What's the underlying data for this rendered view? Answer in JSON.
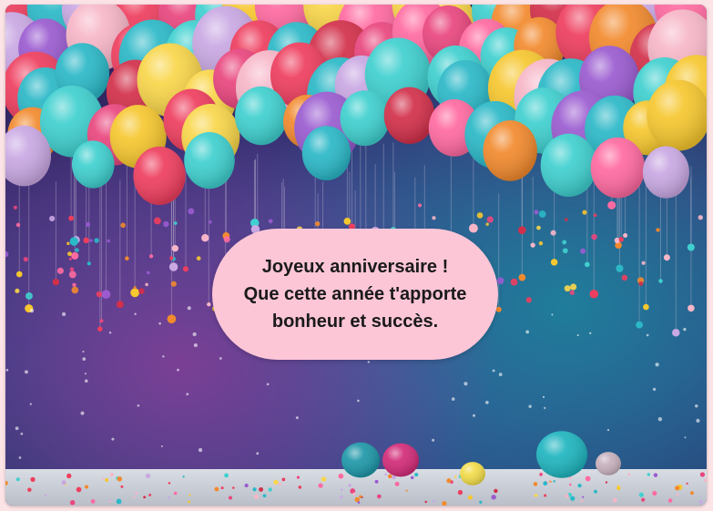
{
  "card": {
    "message_lines": [
      "Joyeux anniversaire !",
      "Que cette année t'apporte",
      "bonheur et succès."
    ]
  },
  "colors": {
    "page_background": "#fbe3e6",
    "bubble_background": "#fcc6d7",
    "text": "#1a1a1a"
  }
}
